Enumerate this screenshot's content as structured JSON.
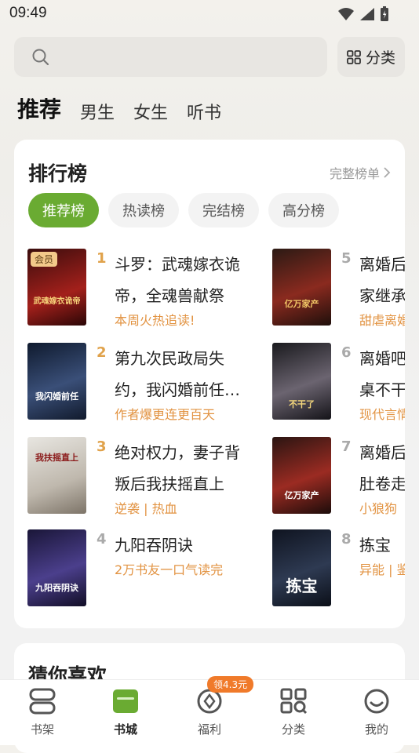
{
  "status": {
    "time": "09:49"
  },
  "search": {
    "placeholder": ""
  },
  "category_button": {
    "label": "分类"
  },
  "top_tabs": [
    {
      "label": "推荐",
      "active": true
    },
    {
      "label": "男生"
    },
    {
      "label": "女生"
    },
    {
      "label": "听书"
    }
  ],
  "ranking": {
    "title": "排行榜",
    "more": "完整榜单",
    "chips": [
      "推荐榜",
      "热读榜",
      "完结榜",
      "高分榜"
    ],
    "books": [
      {
        "rank": "1",
        "title": "斗罗：武魂嫁衣诡帝，全魂兽献祭",
        "tag": "本周火热追读!",
        "vip": "会员",
        "cover_text": "武魂嫁衣诡帝"
      },
      {
        "rank": "2",
        "title": "第九次民政局失约，我闪婚前任…",
        "tag": "作者爆更连更百天",
        "cover_text": "我闪婚前任"
      },
      {
        "rank": "3",
        "title": "绝对权力，妻子背叛后我扶摇直上",
        "tag": "逆袭 | 热血",
        "cover_text": "我扶摇直上"
      },
      {
        "rank": "4",
        "title": "九阳吞阴诀",
        "tag": "2万书友一口气读完",
        "cover_text": "九阳吞阴诀"
      },
      {
        "rank": "5",
        "title": "离婚后",
        "line2": "家继承",
        "tag": "甜虐离婚",
        "cover_text": "亿万家产"
      },
      {
        "rank": "6",
        "title": "离婚吧",
        "line2": "桌不干",
        "tag": "现代言情",
        "cover_text": "不干了"
      },
      {
        "rank": "7",
        "title": "离婚后",
        "line2": "肚卷走",
        "tag": "小狼狗",
        "cover_text": "亿万家产"
      },
      {
        "rank": "8",
        "title": "拣宝",
        "tag": "异能 | 鉴",
        "cover_text": "拣宝"
      }
    ]
  },
  "guess": {
    "title": "猜你喜欢"
  },
  "bottom_nav": [
    {
      "label": "书架"
    },
    {
      "label": "书城",
      "active": true
    },
    {
      "label": "福利",
      "badge": "领4.3元"
    },
    {
      "label": "分类"
    },
    {
      "label": "我的"
    }
  ],
  "colors": {
    "accent": "#6aab32",
    "rank": "#e0a24b",
    "tag": "#e29342"
  }
}
